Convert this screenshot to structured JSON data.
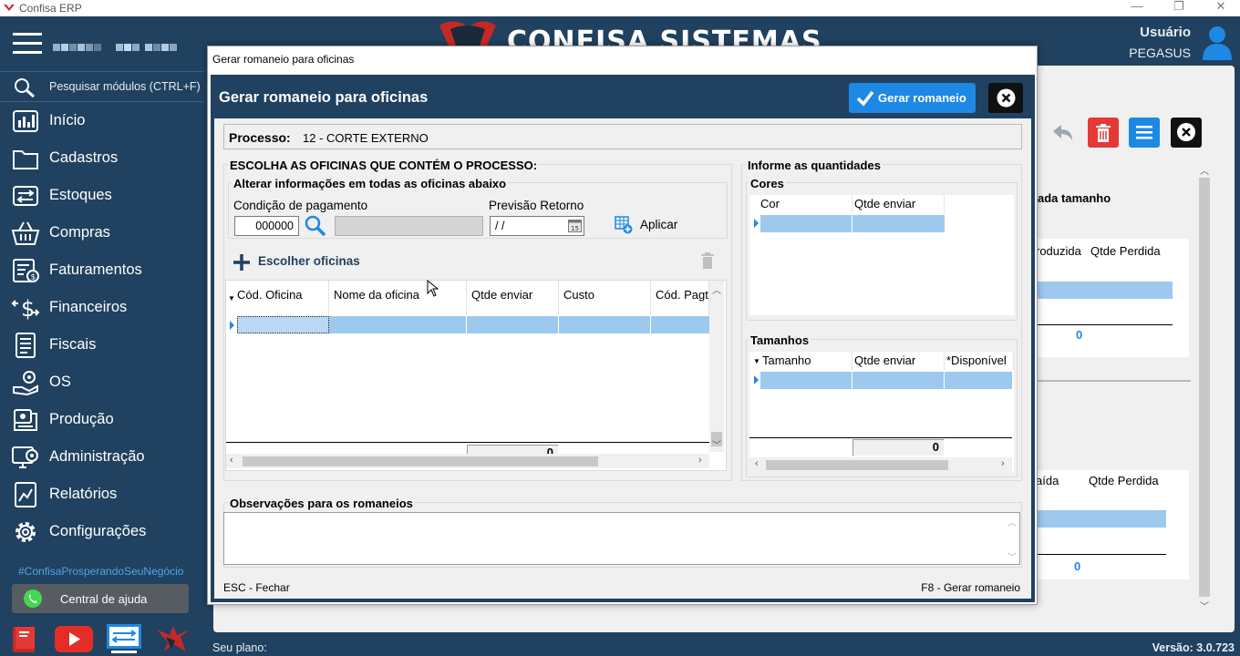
{
  "window": {
    "title": "Confisa ERP",
    "controls": [
      "—",
      "❐",
      "✕"
    ]
  },
  "sidebar": {
    "search_label": "Pesquisar módulos (CTRL+F)",
    "items": [
      {
        "label": "Início",
        "icon": "chart-icon"
      },
      {
        "label": "Cadastros",
        "icon": "folder-icon"
      },
      {
        "label": "Estoques",
        "icon": "stock-icon"
      },
      {
        "label": "Compras",
        "icon": "basket-icon"
      },
      {
        "label": "Faturamentos",
        "icon": "invoice-icon"
      },
      {
        "label": "Financeiros",
        "icon": "money-icon"
      },
      {
        "label": "Fiscais",
        "icon": "document-icon"
      },
      {
        "label": "OS",
        "icon": "service-icon"
      },
      {
        "label": "Produção",
        "icon": "production-icon"
      },
      {
        "label": "Administração",
        "icon": "admin-icon"
      },
      {
        "label": "Relatórios",
        "icon": "report-icon"
      },
      {
        "label": "Configurações",
        "icon": "gear-icon"
      }
    ],
    "hashtag": "#ConfisaProsperandoSeuNegócio",
    "help_label": "Central de ajuda"
  },
  "header": {
    "logo_text": "CONFISA SISTEMAS",
    "user_label": "Usuário",
    "user_name": "PEGASUS"
  },
  "background_window": {
    "group_label": "ada tamanho",
    "grid1_headers": [
      "roduzida",
      "Qtde Perdida"
    ],
    "grid1_total": "0",
    "grid2_headers": [
      "aída",
      "Qtde Perdida"
    ],
    "grid2_total": "0"
  },
  "status_bar": {
    "plan_label": "Seu plano:",
    "version": "Versão: 3.0.723"
  },
  "modal": {
    "window_title": "Gerar romaneio para oficinas",
    "header_title": "Gerar romaneio para oficinas",
    "generate_label": "Gerar romaneio",
    "process_label": "Processo:",
    "process_value": "12 - CORTE EXTERNO",
    "left_group_title": "ESCOLHA AS OFICINAS QUE CONTÉM O PROCESSO:",
    "alter_group_title": "Alterar informações em todas as oficinas abaixo",
    "payment_label": "Condição de pagamento",
    "payment_value": "000000",
    "return_label": "Previsão Retorno",
    "return_value": " / /",
    "apply_label": "Aplicar",
    "choose_label": "Escolher oficinas",
    "workshops_grid": {
      "headers": [
        "Cód. Oficina",
        "Nome da oficina",
        "Qtde enviar",
        "Custo",
        "Cód. Pagto"
      ],
      "total": "0"
    },
    "right_group_title": "Informe as quantidades",
    "colors_title": "Cores",
    "colors_grid": {
      "headers": [
        "Cor",
        "Qtde enviar"
      ]
    },
    "sizes_title": "Tamanhos",
    "sizes_grid": {
      "headers": [
        "Tamanho",
        "Qtde enviar",
        "*Disponível"
      ],
      "total": "0"
    },
    "obs_title": "Observações para os romaneios",
    "obs_value": "",
    "footer_left": "ESC - Fechar",
    "footer_right": "F8 - Gerar romaneio"
  },
  "colors": {
    "sidebar_bg": "#20415f",
    "accent_blue": "#1e88e5",
    "selection": "#9ec9ef",
    "danger": "#e53935"
  }
}
